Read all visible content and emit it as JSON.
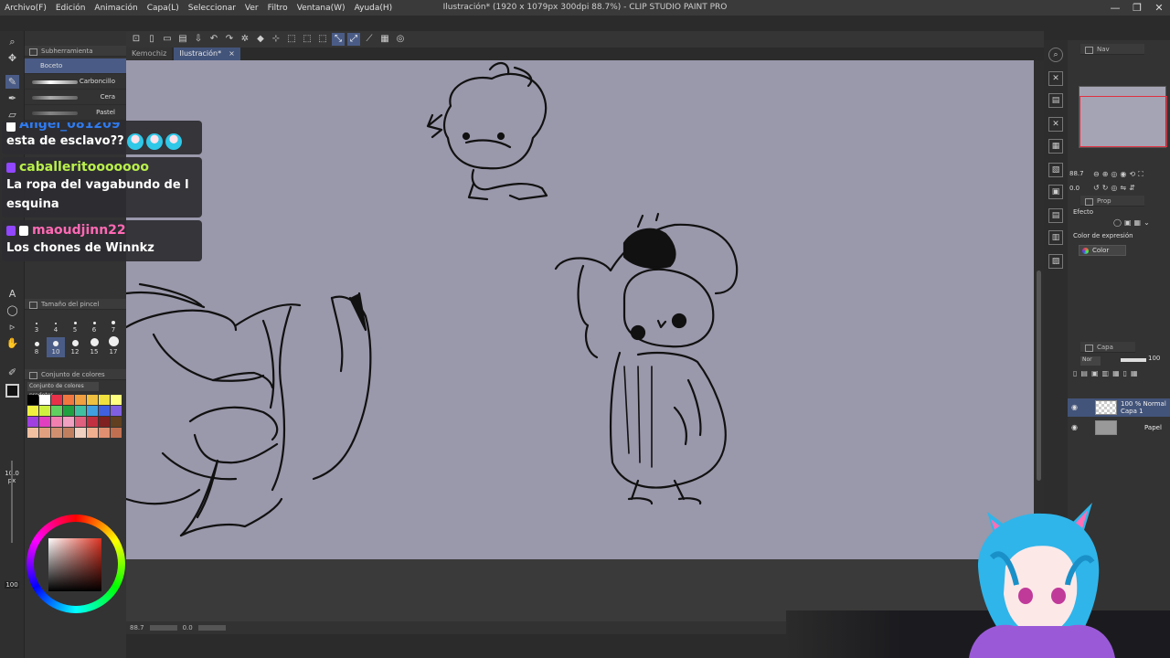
{
  "window": {
    "title": "Ilustración* (1920 x 1079px 300dpi 88.7%)  - CLIP STUDIO PAINT PRO",
    "controls": [
      "—",
      "❐",
      "✕"
    ]
  },
  "menu": [
    "Archivo(F)",
    "Edición",
    "Animación",
    "Capa(L)",
    "Seleccionar",
    "Ver",
    "Filtro",
    "Ventana(W)",
    "Ayuda(H)"
  ],
  "tabs": [
    {
      "label": "Kemochiz",
      "active": false
    },
    {
      "label": "Ilustración*",
      "active": true,
      "close": "×"
    }
  ],
  "subtool": {
    "header": "Subherramienta",
    "items": [
      "Boceto",
      "Carboncillo",
      "Cera",
      "Pastel"
    ],
    "selected": "Boceto"
  },
  "brush_size": {
    "header": "Tamaño del pincel",
    "sizes": [
      "3",
      "4",
      "5",
      "6",
      "7",
      "8",
      "10",
      "12",
      "15",
      "17"
    ],
    "selected": "10"
  },
  "color_set": {
    "header": "Conjunto de colores",
    "select_value": "Conjunto de colores predeter",
    "colors": [
      "#000000",
      "#ffffff",
      "#e8324a",
      "#f07840",
      "#f0a040",
      "#f0c040",
      "#f0e040",
      "#ffff80",
      "#f0f040",
      "#d0f040",
      "#60d060",
      "#20a040",
      "#40c0a0",
      "#40a0e0",
      "#4060e0",
      "#8060e0",
      "#a040e0",
      "#e040c0",
      "#f080b0",
      "#f0a0c0",
      "#e06080",
      "#c03040",
      "#802020",
      "#604020",
      "#f0c0a0",
      "#e0a080",
      "#d09070",
      "#c08060",
      "#f0d0c0",
      "#f0b090",
      "#e09070",
      "#c07050"
    ]
  },
  "left_values": {
    "size": "10.0",
    "size_unit": "px",
    "opacity": "100"
  },
  "navigator": {
    "header": "Nav",
    "zoom": "88.7",
    "rotation": "0.0"
  },
  "tool_property": {
    "header": "Prop",
    "effect_label": "Efecto",
    "color_exp_label": "Color de expresión",
    "color_exp_value": "Color"
  },
  "layers": {
    "header": "Capa",
    "blend_mode": "Nor",
    "opacity": "100",
    "items": [
      {
        "name": "100 % Normal",
        "sub": "Capa 1",
        "selected": true
      },
      {
        "name": "Papel",
        "sub": "",
        "selected": false
      }
    ]
  },
  "status": {
    "zoom": "88.7",
    "value": "0.0"
  },
  "chat": [
    {
      "user": "Angel_081209",
      "color": "#2f7bf0",
      "text": "esta de esclavo??",
      "emotes": 3
    },
    {
      "user": "caballeritooooooo",
      "color": "#b9f04b",
      "text": "La ropa del vagabundo de l esquina",
      "emotes": 0
    },
    {
      "user": "maoudjinn22",
      "color": "#ff69b4",
      "text": "Los chones de Winnkz",
      "emotes": 0
    }
  ],
  "colors": {
    "canvas_bg": "#9a98ab",
    "ui_dark": "#333333",
    "accent": "#4a5c86",
    "avatar_hair": "#2fb5ea",
    "avatar_ears": "#ff6fb5"
  },
  "icons": {
    "tools": [
      "zoom-icon",
      "move-icon",
      "pen-icon",
      "pencil-icon",
      "brush-icon",
      "eraser-icon",
      "text-icon",
      "lasso-icon",
      "select-icon",
      "hand-icon",
      "eyedropper-icon"
    ]
  }
}
